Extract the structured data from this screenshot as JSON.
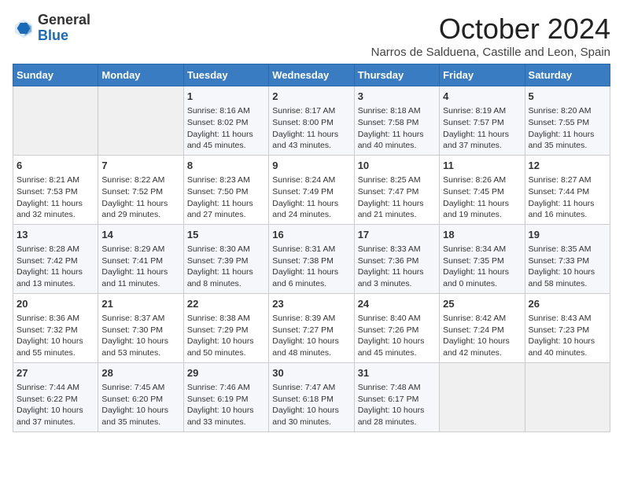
{
  "logo": {
    "general": "General",
    "blue": "Blue"
  },
  "header": {
    "month": "October 2024",
    "location": "Narros de Salduena, Castille and Leon, Spain"
  },
  "weekdays": [
    "Sunday",
    "Monday",
    "Tuesday",
    "Wednesday",
    "Thursday",
    "Friday",
    "Saturday"
  ],
  "weeks": [
    [
      {
        "day": "",
        "detail": ""
      },
      {
        "day": "",
        "detail": ""
      },
      {
        "day": "1",
        "detail": "Sunrise: 8:16 AM\nSunset: 8:02 PM\nDaylight: 11 hours and 45 minutes."
      },
      {
        "day": "2",
        "detail": "Sunrise: 8:17 AM\nSunset: 8:00 PM\nDaylight: 11 hours and 43 minutes."
      },
      {
        "day": "3",
        "detail": "Sunrise: 8:18 AM\nSunset: 7:58 PM\nDaylight: 11 hours and 40 minutes."
      },
      {
        "day": "4",
        "detail": "Sunrise: 8:19 AM\nSunset: 7:57 PM\nDaylight: 11 hours and 37 minutes."
      },
      {
        "day": "5",
        "detail": "Sunrise: 8:20 AM\nSunset: 7:55 PM\nDaylight: 11 hours and 35 minutes."
      }
    ],
    [
      {
        "day": "6",
        "detail": "Sunrise: 8:21 AM\nSunset: 7:53 PM\nDaylight: 11 hours and 32 minutes."
      },
      {
        "day": "7",
        "detail": "Sunrise: 8:22 AM\nSunset: 7:52 PM\nDaylight: 11 hours and 29 minutes."
      },
      {
        "day": "8",
        "detail": "Sunrise: 8:23 AM\nSunset: 7:50 PM\nDaylight: 11 hours and 27 minutes."
      },
      {
        "day": "9",
        "detail": "Sunrise: 8:24 AM\nSunset: 7:49 PM\nDaylight: 11 hours and 24 minutes."
      },
      {
        "day": "10",
        "detail": "Sunrise: 8:25 AM\nSunset: 7:47 PM\nDaylight: 11 hours and 21 minutes."
      },
      {
        "day": "11",
        "detail": "Sunrise: 8:26 AM\nSunset: 7:45 PM\nDaylight: 11 hours and 19 minutes."
      },
      {
        "day": "12",
        "detail": "Sunrise: 8:27 AM\nSunset: 7:44 PM\nDaylight: 11 hours and 16 minutes."
      }
    ],
    [
      {
        "day": "13",
        "detail": "Sunrise: 8:28 AM\nSunset: 7:42 PM\nDaylight: 11 hours and 13 minutes."
      },
      {
        "day": "14",
        "detail": "Sunrise: 8:29 AM\nSunset: 7:41 PM\nDaylight: 11 hours and 11 minutes."
      },
      {
        "day": "15",
        "detail": "Sunrise: 8:30 AM\nSunset: 7:39 PM\nDaylight: 11 hours and 8 minutes."
      },
      {
        "day": "16",
        "detail": "Sunrise: 8:31 AM\nSunset: 7:38 PM\nDaylight: 11 hours and 6 minutes."
      },
      {
        "day": "17",
        "detail": "Sunrise: 8:33 AM\nSunset: 7:36 PM\nDaylight: 11 hours and 3 minutes."
      },
      {
        "day": "18",
        "detail": "Sunrise: 8:34 AM\nSunset: 7:35 PM\nDaylight: 11 hours and 0 minutes."
      },
      {
        "day": "19",
        "detail": "Sunrise: 8:35 AM\nSunset: 7:33 PM\nDaylight: 10 hours and 58 minutes."
      }
    ],
    [
      {
        "day": "20",
        "detail": "Sunrise: 8:36 AM\nSunset: 7:32 PM\nDaylight: 10 hours and 55 minutes."
      },
      {
        "day": "21",
        "detail": "Sunrise: 8:37 AM\nSunset: 7:30 PM\nDaylight: 10 hours and 53 minutes."
      },
      {
        "day": "22",
        "detail": "Sunrise: 8:38 AM\nSunset: 7:29 PM\nDaylight: 10 hours and 50 minutes."
      },
      {
        "day": "23",
        "detail": "Sunrise: 8:39 AM\nSunset: 7:27 PM\nDaylight: 10 hours and 48 minutes."
      },
      {
        "day": "24",
        "detail": "Sunrise: 8:40 AM\nSunset: 7:26 PM\nDaylight: 10 hours and 45 minutes."
      },
      {
        "day": "25",
        "detail": "Sunrise: 8:42 AM\nSunset: 7:24 PM\nDaylight: 10 hours and 42 minutes."
      },
      {
        "day": "26",
        "detail": "Sunrise: 8:43 AM\nSunset: 7:23 PM\nDaylight: 10 hours and 40 minutes."
      }
    ],
    [
      {
        "day": "27",
        "detail": "Sunrise: 7:44 AM\nSunset: 6:22 PM\nDaylight: 10 hours and 37 minutes."
      },
      {
        "day": "28",
        "detail": "Sunrise: 7:45 AM\nSunset: 6:20 PM\nDaylight: 10 hours and 35 minutes."
      },
      {
        "day": "29",
        "detail": "Sunrise: 7:46 AM\nSunset: 6:19 PM\nDaylight: 10 hours and 33 minutes."
      },
      {
        "day": "30",
        "detail": "Sunrise: 7:47 AM\nSunset: 6:18 PM\nDaylight: 10 hours and 30 minutes."
      },
      {
        "day": "31",
        "detail": "Sunrise: 7:48 AM\nSunset: 6:17 PM\nDaylight: 10 hours and 28 minutes."
      },
      {
        "day": "",
        "detail": ""
      },
      {
        "day": "",
        "detail": ""
      }
    ]
  ]
}
